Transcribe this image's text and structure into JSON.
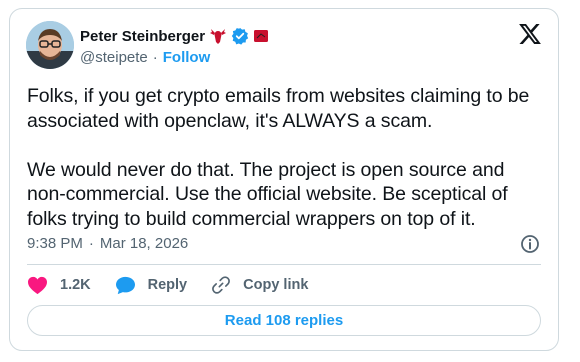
{
  "author": {
    "name": "Peter Steinberger",
    "handle": "@steipete",
    "separator": "·",
    "follow_label": "Follow",
    "icons": [
      "lobster-emoji",
      "verified-badge-icon",
      "red-square-emoji"
    ]
  },
  "brand": {
    "logo": "x-logo-icon"
  },
  "tweet": {
    "text": "Folks, if you get crypto emails from websites claiming to be associated with openclaw, it's ALWAYS a scam.\n\nWe would never do that. The project is open source and non-commercial. Use the official website. Be sceptical of folks trying to build commercial wrappers on top of it.",
    "time": "9:38 PM",
    "separator": "·",
    "date": "Mar 18, 2026"
  },
  "actions": {
    "likes": "1.2K",
    "reply_label": "Reply",
    "copy_label": "Copy link"
  },
  "replies_button": "Read 108 replies",
  "colors": {
    "accent": "#1d9bf0",
    "like": "#f91880",
    "text": "#0f1419",
    "muted": "#536471",
    "border": "#cfd9de"
  }
}
